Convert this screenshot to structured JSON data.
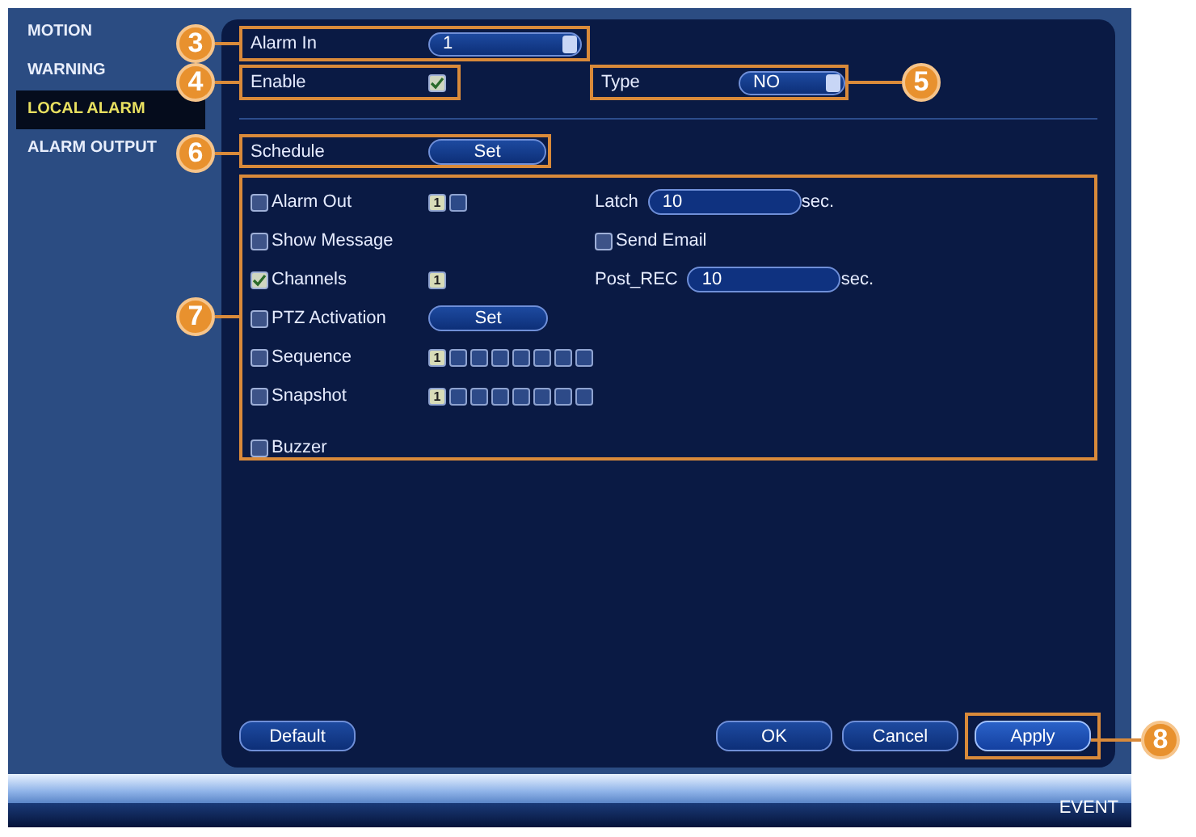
{
  "sidebar": {
    "items": [
      {
        "label": "MOTION",
        "selected": false
      },
      {
        "label": "WARNING",
        "selected": false
      },
      {
        "label": "LOCAL ALARM",
        "selected": true
      },
      {
        "label": "ALARM OUTPUT",
        "selected": false
      }
    ]
  },
  "alarm_in": {
    "label": "Alarm In",
    "value": "1"
  },
  "enable": {
    "label": "Enable",
    "checked": true
  },
  "type": {
    "label": "Type",
    "value": "NO"
  },
  "schedule": {
    "label": "Schedule",
    "button": "Set"
  },
  "actions": [
    {
      "kind": "channels",
      "label": "Alarm Out",
      "checked": false,
      "channels": [
        {
          "label": "1",
          "selected": true
        },
        {
          "selected": false
        }
      ],
      "right": {
        "kind": "field",
        "label": "Latch",
        "value": "10",
        "unit": "sec."
      }
    },
    {
      "kind": "plain",
      "label": "Show Message",
      "checked": false,
      "right": {
        "kind": "checkbox",
        "label": "Send Email",
        "checked": false
      }
    },
    {
      "kind": "channels",
      "label": "Channels",
      "checked": true,
      "channels": [
        {
          "label": "1",
          "selected": true
        }
      ],
      "right": {
        "kind": "field",
        "label": "Post_REC",
        "value": "10",
        "unit": "sec."
      }
    },
    {
      "kind": "button",
      "label": "PTZ Activation",
      "checked": false,
      "button": "Set"
    },
    {
      "kind": "channels",
      "label": "Sequence",
      "checked": false,
      "channels": [
        {
          "label": "1",
          "selected": true
        },
        {
          "selected": false
        },
        {
          "selected": false
        },
        {
          "selected": false
        },
        {
          "selected": false
        },
        {
          "selected": false
        },
        {
          "selected": false
        },
        {
          "selected": false
        }
      ]
    },
    {
      "kind": "channels",
      "label": "Snapshot",
      "checked": false,
      "channels": [
        {
          "label": "1",
          "selected": true
        },
        {
          "selected": false
        },
        {
          "selected": false
        },
        {
          "selected": false
        },
        {
          "selected": false
        },
        {
          "selected": false
        },
        {
          "selected": false
        },
        {
          "selected": false
        }
      ]
    },
    {
      "kind": "plain",
      "label": "Buzzer",
      "checked": false
    }
  ],
  "buttons": [
    {
      "label": "Default",
      "selected": false
    },
    {
      "label": "OK",
      "selected": false
    },
    {
      "label": "Cancel",
      "selected": false
    },
    {
      "label": "Apply",
      "selected": true
    }
  ],
  "footer": {
    "title": "EVENT"
  },
  "callouts": [
    {
      "number": "3"
    },
    {
      "number": "4"
    },
    {
      "number": "5"
    },
    {
      "number": "6"
    },
    {
      "number": "7"
    },
    {
      "number": "8"
    }
  ]
}
